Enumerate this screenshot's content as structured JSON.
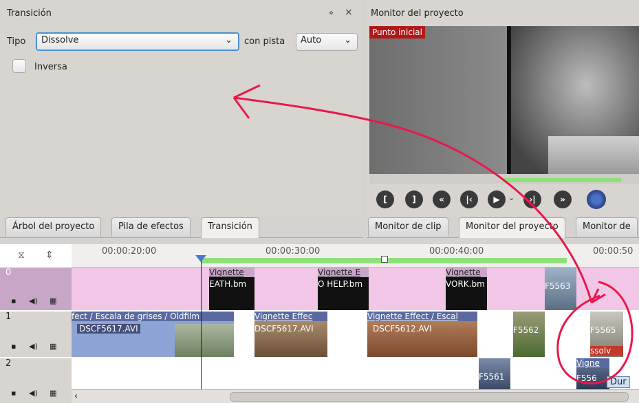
{
  "transition_panel": {
    "title": "Transición",
    "float_btn": "⋄",
    "close_btn": "×",
    "tipo_label": "Tipo",
    "tipo_value": "Dissolve",
    "con_pista_label": "con pista",
    "con_pista_value": "Auto",
    "inversa_label": "Inversa"
  },
  "monitor_panel": {
    "title": "Monitor del proyecto",
    "overlay_label": "Punto inicial"
  },
  "left_tabs": [
    "Árbol del proyecto",
    "Pila de efectos",
    "Transición"
  ],
  "right_tabs": [
    "Monitor de clip",
    "Monitor del proyecto",
    "Monitor de"
  ],
  "timeline": {
    "ruler_labels": [
      "00:00:20:00",
      "00:00:30:00",
      "00:00:40:00",
      "00:00:50"
    ],
    "tracks": [
      "0",
      "1",
      "2"
    ],
    "track0_clips": [
      "Vignette",
      "EATH.bm",
      "Vignette E",
      "O HELP.bm",
      "Vignette",
      "VORK.bm",
      "F5563"
    ],
    "track1_clips": [
      "fect / Escala de grises / Oldfilm",
      "DSCF5617.AVI",
      "Vignette Effec",
      "DSCF5617.AVI",
      "Vignette Effect / Escal",
      "DSCF5612.AVI",
      "F5562",
      "F5565",
      "ssolv"
    ],
    "track2_clips": [
      "F5561",
      "Vigne",
      "F556"
    ],
    "tooltip": "Dur"
  },
  "colors": {
    "track0_bg": "#f2c6e6",
    "track_header_purple": "#c8a6c8",
    "clip_blue": "#8ea4d6",
    "ruler_green": "#8fe07c",
    "annotation_red": "#e8194a"
  },
  "icons": [
    "float-icon",
    "close-icon",
    "chevron-down-icon",
    "lock-icon",
    "audio-icon",
    "video-icon",
    "hourglass-icon",
    "updown-icon",
    "gear-icon"
  ]
}
